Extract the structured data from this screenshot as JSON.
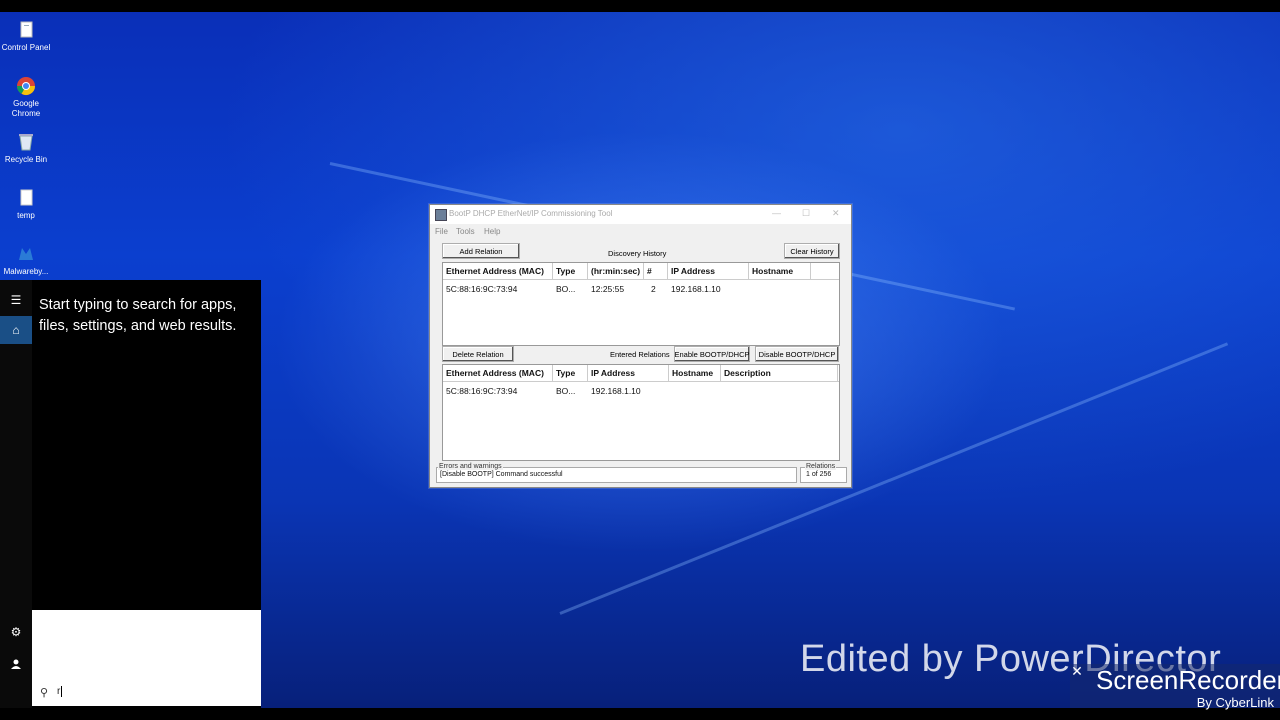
{
  "desktop": {
    "icons": [
      {
        "label": "Control Panel",
        "icon": "control-panel-icon"
      },
      {
        "label": "Google Chrome",
        "icon": "chrome-icon"
      },
      {
        "label": "Recycle Bin",
        "icon": "recycle-bin-icon"
      },
      {
        "label": "temp",
        "icon": "file-icon"
      },
      {
        "label": "Malwareby... Threat Sca...",
        "icon": "malwarebytes-icon"
      }
    ]
  },
  "start": {
    "hint": "Start typing to search for apps, files, settings, and web results.",
    "search_value": "r",
    "rail_icons": [
      "hamburger-icon",
      "home-icon",
      "gear-icon",
      "user-icon"
    ]
  },
  "app": {
    "title": "BootP DHCP EtherNet/IP Commissioning Tool",
    "menu": [
      "File",
      "Tools",
      "Help"
    ],
    "buttons": {
      "add_relation": "Add Relation",
      "clear_history": "Clear History",
      "delete_relation": "Delete Relation",
      "enable_bootp": "Enable BOOTP/DHCP",
      "disable_bootp": "Disable BOOTP/DHCP"
    },
    "labels": {
      "discovery_history": "Discovery History",
      "entered_relations": "Entered Relations",
      "errors_warnings": "Errors and warnings",
      "relations": "Relations"
    },
    "history": {
      "headers": [
        "Ethernet Address (MAC)",
        "Type",
        "(hr:min:sec)",
        "#",
        "IP Address",
        "Hostname"
      ],
      "rows": [
        [
          "5C:88:16:9C:73:94",
          "BO...",
          "12:25:55",
          "2",
          "192.168.1.10",
          ""
        ]
      ]
    },
    "relations": {
      "headers": [
        "Ethernet Address (MAC)",
        "Type",
        "IP Address",
        "Hostname",
        "Description"
      ],
      "rows": [
        [
          "5C:88:16:9C:73:94",
          "BO...",
          "192.168.1.10",
          "",
          ""
        ]
      ]
    },
    "status_message": "[Disable BOOTP] Command successful",
    "relations_count": "1 of 256"
  },
  "watermark": {
    "edited_by": "Edited by PowerDirector",
    "recorder": "ScreenRecorder",
    "by": "By CyberLink"
  }
}
